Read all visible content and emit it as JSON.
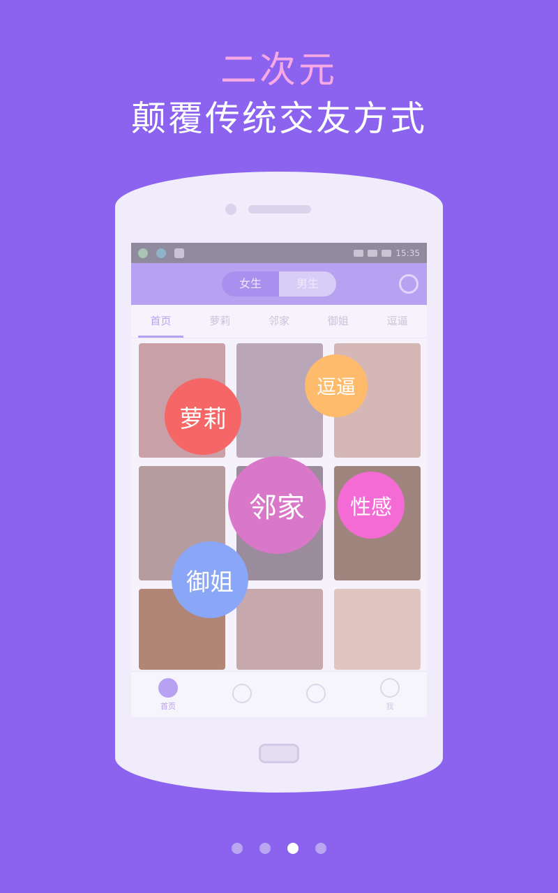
{
  "headline": {
    "line1": "二次元",
    "line2": "颠覆传统交友方式"
  },
  "status_bar": {
    "time": "15:35"
  },
  "app_bar": {
    "gender_options": [
      "女生",
      "男生"
    ],
    "selected_gender": "女生"
  },
  "tabs": [
    "首页",
    "萝莉",
    "邻家",
    "御姐",
    "逗逼"
  ],
  "selected_tab": "首页",
  "cards": [
    {
      "caption": "",
      "color": "#c9a0a8"
    },
    {
      "caption": "",
      "color": "#b9a6b8"
    },
    {
      "caption": "",
      "color": "#d5b7b5"
    },
    {
      "caption": "",
      "color": "#b79c9f"
    },
    {
      "caption": "",
      "color": "#9a8c9d"
    },
    {
      "caption": "",
      "color": "#a0857e"
    },
    {
      "caption": "",
      "color": "#b28676"
    },
    {
      "caption": "",
      "color": "#c7a9ad"
    },
    {
      "caption": "",
      "color": "#e0c5c1"
    }
  ],
  "bottom_nav": [
    "首页",
    "",
    "",
    "我"
  ],
  "bubbles": {
    "luoli": "萝莉",
    "doubi": "逗逼",
    "linjia": "邻家",
    "xinggan": "性感",
    "yujie": "御姐"
  },
  "pagination": {
    "total": 4,
    "current": 3
  },
  "colors": {
    "background": "#8b63ef",
    "accent": "#b7a2f1"
  }
}
